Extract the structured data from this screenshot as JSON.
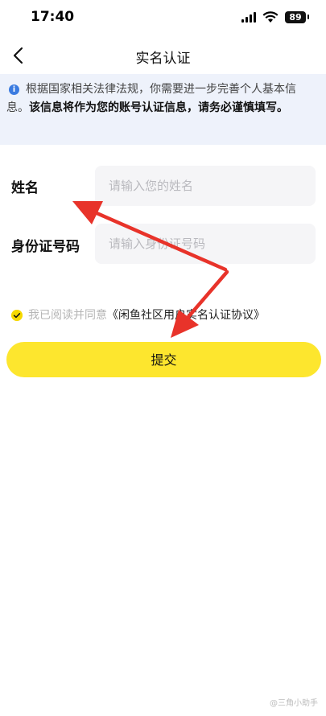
{
  "status_bar": {
    "time": "17:40",
    "battery": "89"
  },
  "nav": {
    "title": "实名认证"
  },
  "notice": {
    "text": "根据国家相关法律法规，你需要进一步完善个人基本信息。",
    "bold": "该信息将作为您的账号认证信息，请务必谨慎填写。"
  },
  "form": {
    "name_label": "姓名",
    "name_placeholder": "请输入您的姓名",
    "id_label": "身份证号码",
    "id_placeholder": "请输入身份证号码"
  },
  "agreement": {
    "checked": true,
    "text": "我已阅读并同意",
    "link": "《闲鱼社区用户实名认证协议》"
  },
  "submit_label": "提交",
  "watermark": "@三角小助手",
  "colors": {
    "accent": "#fde62e",
    "arrow": "#e8332a",
    "info": "#3b7be0"
  }
}
